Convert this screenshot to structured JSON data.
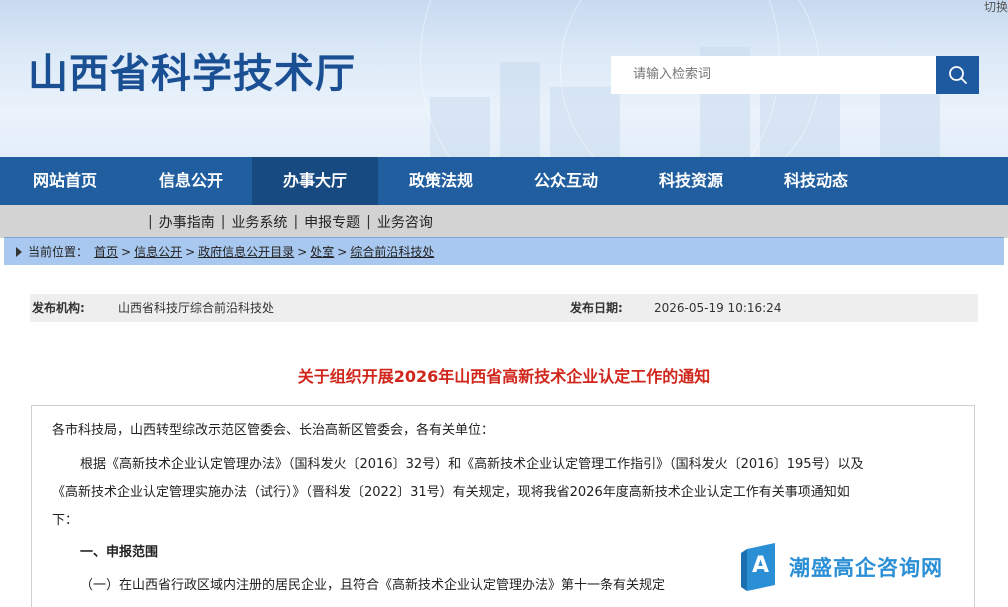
{
  "header": {
    "switch_label": "切换",
    "site_title": "山西省科学技术厅",
    "search_placeholder": "请输入检索词",
    "search_icon": "search-icon"
  },
  "nav": {
    "items": [
      {
        "label": "网站首页"
      },
      {
        "label": "信息公开"
      },
      {
        "label": "办事大厅"
      },
      {
        "label": "政策法规"
      },
      {
        "label": "公众互动"
      },
      {
        "label": "科技资源"
      },
      {
        "label": "科技动态"
      }
    ],
    "active": "办事大厅"
  },
  "subnav": {
    "items": [
      {
        "label": "办事指南"
      },
      {
        "label": "业务系统"
      },
      {
        "label": "申报专题"
      },
      {
        "label": "业务咨询"
      }
    ]
  },
  "breadcrumb": {
    "prefix": "当前位置：",
    "items": [
      {
        "label": "首页"
      },
      {
        "label": "信息公开"
      },
      {
        "label": "政府信息公开目录"
      },
      {
        "label": "处室"
      },
      {
        "label": "综合前沿科技处"
      }
    ],
    "separator": ">"
  },
  "meta": {
    "publisher_label": "发布机构:",
    "publisher_value": "山西省科技厅综合前沿科技处",
    "date_label": "发布日期:",
    "date_value": "2026-05-19 10:16:24"
  },
  "document": {
    "title": "关于组织开展2026年山西省高新技术企业认定工作的通知",
    "salutation": "各市科技局，山西转型综改示范区管委会、长治高新区管委会，各有关单位：",
    "para1_line1": "根据《高新技术企业认定管理办法》（国科发火〔2016〕32号）和《高新技术企业认定管理工作指引》（国科发火〔2016〕195号）以及",
    "para1_line2": "《高新技术企业认定管理实施办法（试行）》（晋科发〔2022〕31号）有关规定，现将我省2026年度高新技术企业认定工作有关事项通知如",
    "para1_line3": "下：",
    "section1": "一、申报范围",
    "item1": "（一）在山西省行政区域内注册的居民企业，且符合《高新技术企业认定管理办法》第十一条有关规定"
  },
  "watermark": {
    "text": "潮盛高企咨询网",
    "logo_letter": "A"
  },
  "colors": {
    "brand_blue": "#1a4f94",
    "nav_bg": "#205e9f",
    "nav_active": "#174a80",
    "title_red": "#d0261c",
    "watermark_blue": "#2b8fd6"
  }
}
